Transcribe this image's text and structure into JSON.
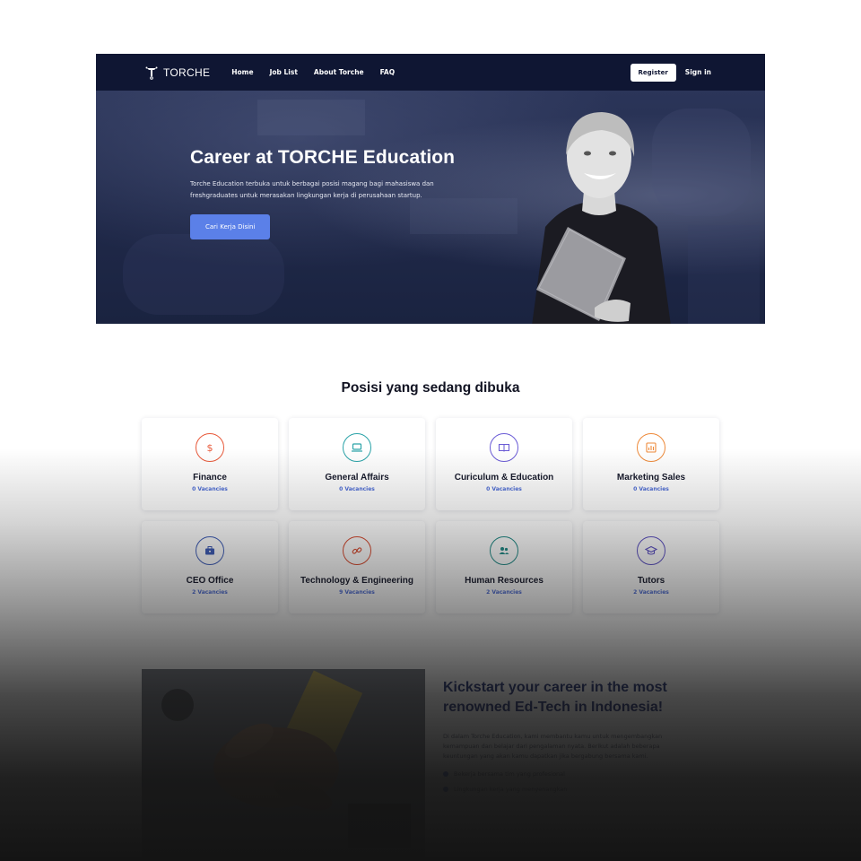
{
  "nav": {
    "logo_text": "TORCHE",
    "links": [
      "Home",
      "Job List",
      "About Torche",
      "FAQ"
    ],
    "register_label": "Register",
    "signin_label": "Sign in"
  },
  "hero": {
    "title": "Career at TORCHE Education",
    "description": "Torche Education terbuka untuk berbagai posisi magang bagi mahasiswa dan freshgraduates untuk merasakan lingkungan kerja di perusahaan startup.",
    "cta_label": "Cari Kerja Disini"
  },
  "positions": {
    "title": "Posisi yang sedang dibuka",
    "cards": [
      {
        "name": "Finance",
        "count": "0 Vacancies",
        "icon": "dollar-icon",
        "color": "#e8593a"
      },
      {
        "name": "General Affairs",
        "count": "0 Vacancies",
        "icon": "laptop-icon",
        "color": "#2aa3a8"
      },
      {
        "name": "Curiculum & Education",
        "count": "0 Vacancies",
        "icon": "book-icon",
        "color": "#6a5bd6"
      },
      {
        "name": "Marketing Sales",
        "count": "0 Vacancies",
        "icon": "chart-icon",
        "color": "#ee8a3a"
      },
      {
        "name": "CEO Office",
        "count": "2 Vacancies",
        "icon": "briefcase-icon",
        "color": "#3c5bb8"
      },
      {
        "name": "Technology & Engineering",
        "count": "9 Vacancies",
        "icon": "link-icon",
        "color": "#d9472b"
      },
      {
        "name": "Human Resources",
        "count": "2 Vacancies",
        "icon": "users-icon",
        "color": "#1d8a86"
      },
      {
        "name": "Tutors",
        "count": "2 Vacancies",
        "icon": "graduation-cap-icon",
        "color": "#5b4fc4"
      }
    ]
  },
  "kickstart": {
    "title": "Kickstart your career in the most renowned Ed-Tech in Indonesia!",
    "description": "Di dalam Torche Education, kami membantu kamu untuk mengembangkan kemampuan dan belajar dari pengalaman nyata. Berikut adalah beberapa keuntungan yang akan kamu dapatkan jika bergabung bersama kami.",
    "bullets": [
      "Bekerja bersama tim yang profesional",
      "Lingkungan kerja yang menyenangkan"
    ]
  },
  "colors": {
    "nav_bg": "#0f1633",
    "accent": "#5b80e8",
    "count_blue": "#4a6ad6"
  }
}
